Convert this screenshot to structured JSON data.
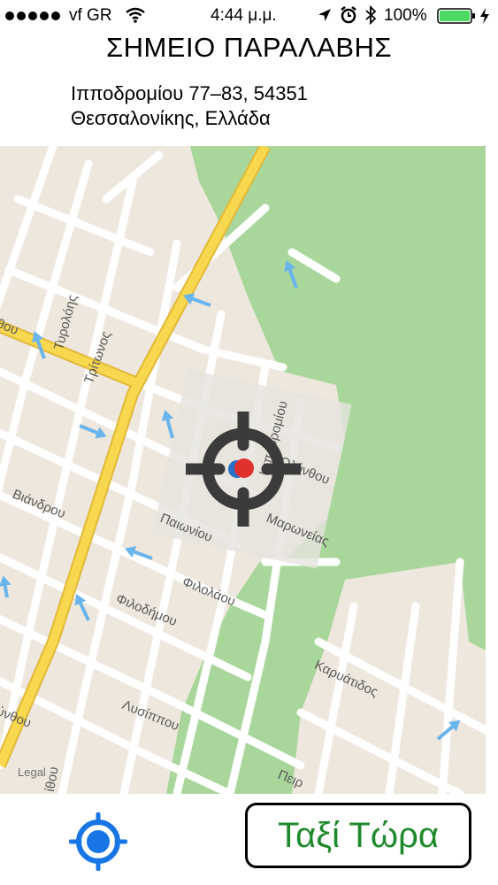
{
  "status_bar": {
    "carrier": "vf GR",
    "time": "4:44 μ.μ.",
    "battery_percent": "100%",
    "battery_level": 1.0,
    "icons": [
      "signal-dots-icon",
      "wifi-icon",
      "location-arrow-icon",
      "alarm-icon",
      "bluetooth-icon",
      "battery-icon",
      "charging-bolt-icon"
    ]
  },
  "header": {
    "title": "ΣΗΜΕΙΟ ΠΑΡΑΛΑΒΗΣ",
    "address_line1": "Ιπποδρομίου 77–83, 54351",
    "address_line2": "Θεσσαλονίκης, Ελλάδα"
  },
  "map": {
    "streets": [
      "Τυρολόης",
      "Τρίτωνος",
      "Ιπποδρομίου",
      "Ολύνθου",
      "Μαρωνείας",
      "Βιάνδρου",
      "Παιωνίου",
      "Φιλολάου",
      "Φιλοδήμου",
      "Καρυάτιδος",
      "Λυσίππου",
      "ύνθου",
      "Πειρ",
      "ίθου",
      "θου"
    ],
    "legal": "Legal",
    "marker": "crosshair-pin-icon",
    "colors": {
      "park": "#a9d79b",
      "land": "#eee7dd",
      "road": "#ffffff",
      "highway": "#f8d84e",
      "oneway": "#6ab4ec",
      "marker": "#3b3b3b",
      "pin": "#e0322c"
    }
  },
  "bottom": {
    "locate_icon": "location-target-icon",
    "taxi_button": "Ταξί Τώρα",
    "taxi_color": "#1f8a2c",
    "locate_color": "#1875e6"
  }
}
